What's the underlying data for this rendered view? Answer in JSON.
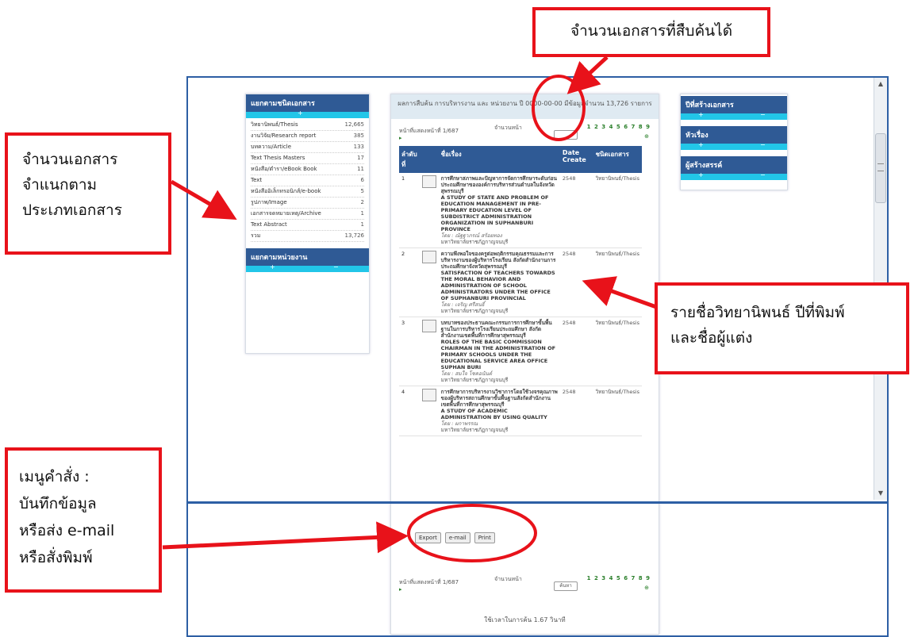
{
  "callouts": {
    "document_count": "จำนวนเอกสารที่สืบค้นได้",
    "document_type": [
      "จำนวนเอกสาร",
      "จำแนกตาม",
      "ประเภทเอกสาร"
    ],
    "result_list": [
      "รายชื่อวิทยานิพนธ์ ปีที่พิมพ์",
      "และชื่อผู้แต่ง"
    ],
    "command_menu": [
      "เมนูคำสั่ง :",
      "บันทึกข้อมูล",
      "หรือส่ง e-mail",
      "หรือสั่งพิมพ์"
    ]
  },
  "left_panel": {
    "heading": "แยกตามชนิดเอกสาร",
    "items": [
      {
        "name": "วิทยานิพนธ์/Thesis",
        "count": "12,665"
      },
      {
        "name": "งานวิจัย/Research report",
        "count": "385"
      },
      {
        "name": "บทความ/Article",
        "count": "133"
      },
      {
        "name": "Text Thesis Masters",
        "count": "17"
      },
      {
        "name": "หนังสือ/ตำรา/eBook Book",
        "count": "11"
      },
      {
        "name": "Text",
        "count": "6"
      },
      {
        "name": "หนังสืออิเล็กทรอนิกส์/e-book",
        "count": "5"
      },
      {
        "name": "รูปภาพ/Image",
        "count": "2"
      },
      {
        "name": "เอกสารจดหมายเหตุ/Archive",
        "count": "1"
      },
      {
        "name": "Text Abstract",
        "count": "1"
      },
      {
        "name": "รวม",
        "count": "13,726"
      }
    ],
    "heading2": "แยกตามหน่วยงาน"
  },
  "right_panel": {
    "sections": [
      "ปีที่สร้างเอกสาร",
      "หัวเรื่อง",
      "ผู้สร้างสรรค์"
    ]
  },
  "results": {
    "summary": "ผลการสืบค้น การบริหารงาน และ หน่วยงาน ปี 0000-00-00 มีข้อมูลจำนวน 13,726 รายการ",
    "pager": {
      "label": "หน้าที่แสดงหน้าที่ 1/687",
      "count_label": "จำนวนหน้า",
      "pages": "1 2 3 4 5 6 7 8 9"
    },
    "columns": [
      "ลำดับที่",
      "ชื่อเรื่อง",
      "Date Create",
      "ชนิดเอกสาร"
    ],
    "rows": [
      {
        "num": "1",
        "th_title": "การศึกษาสภาพและปัญหาการจัดการศึกษาระดับก่อนประถมศึกษาขององค์การบริหารส่วนตำบลในจังหวัดสุพรรณบุรี",
        "en_title": "A STUDY OF STATE AND PROBLEM OF EDUCATION MANAGEMENT IN PRE-PRIMARY EDUCATION LEVEL OF SUBDISTRICT ADMINISTRATION ORGANIZATION IN SUPHANBURI PROVINCE",
        "author": "โดย : ณัฐฐาภรณ์ สร้อยทอง",
        "univ": "มหาวิทยาลัยราชภัฏกาญจนบุรี",
        "year": "2548",
        "type": "วิทยานิพนธ์/Thesis"
      },
      {
        "num": "2",
        "th_title": "ความพึงพอใจของครูต่อพฤติกรรมคุณธรรมและการบริหารงานของผู้บริหารโรงเรียน สังกัดสำนักงานการประถมศึกษาจังหวัดสุพรรณบุรี",
        "en_title": "SATISFACTION OF TEACHERS TOWARDS THE MORAL BEHAVIOR AND ADMINISTRATION OF SCHOOL ADMINISTRATORS UNDER THE OFFICE OF SUPHANBURI PROVINCIAL",
        "author": "โดย : เจริญ ศรีสนธิ์",
        "univ": "มหาวิทยาลัยราชภัฏกาญจนบุรี",
        "year": "2548",
        "type": "วิทยานิพนธ์/Thesis"
      },
      {
        "num": "3",
        "th_title": "บทบาทของประธานคณะกรรมการการศึกษาขั้นพื้นฐานในการบริหารโรงเรียนประถมศึกษา สังกัดสำนักงานเขตพื้นที่การศึกษาสุพรรณบุรี",
        "en_title": "ROLES OF THE BASIC COMMISSION CHAIRMAN IN THE ADMINISTRATION OF PRIMARY SCHOOLS UNDER THE EDUCATIONAL SERVICE AREA OFFICE SUPHAN BURI",
        "author": "โดย : สมใจ โชคอนันต์",
        "univ": "มหาวิทยาลัยราชภัฏกาญจนบุรี",
        "year": "2548",
        "type": "วิทยานิพนธ์/Thesis"
      },
      {
        "num": "4",
        "th_title": "การศึกษาการบริหารงานวิชาการโดยใช้วงจรคุณภาพของผู้บริหารสถานศึกษาขั้นพื้นฐานสังกัดสำนักงานเขตพื้นที่การศึกษาสุพรรณบุรี",
        "en_title": "A STUDY OF ACADEMIC ADMINISTRATION BY USING QUALITY",
        "author": "โดย : ผกาพรรณ",
        "univ": "มหาวิทยาลัยราชภัฏกาญจนบุรี",
        "year": "2548",
        "type": "วิทยานิพนธ์/Thesis"
      }
    ],
    "buttons": {
      "export": "Export",
      "email": "e-mail",
      "print": "Print"
    },
    "bottom_pager": {
      "label": "หน้าที่แสดงหน้าที่ 1/687",
      "count_label": "จำนวนหน้า",
      "box": "ค้นหา",
      "pages": "1 2 3 4 5 6 7 8 9"
    },
    "search_time": "ใช้เวลาในการค้น 1.67 วินาที"
  }
}
